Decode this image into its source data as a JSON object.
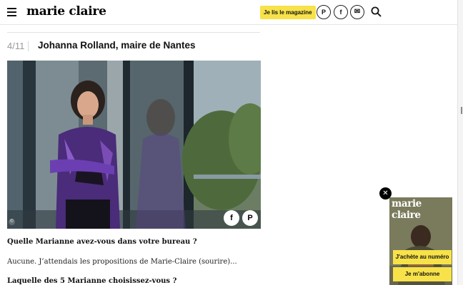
{
  "header": {
    "logo": "marie claire",
    "magazine_button": "Je lis le magazine",
    "social": [
      "P",
      "f",
      "✉"
    ]
  },
  "slide": {
    "counter": "4/11",
    "title": "Johanna Rolland, maire de Nantes",
    "copyright_symbol": "©",
    "share": [
      "f",
      "P"
    ]
  },
  "article": {
    "q1": "Quelle Marianne avez-vous dans votre bureau ?",
    "a1": "Aucune. J’attendais les propositions de Marie-Claire (sourire)...",
    "q2": "Laquelle des 5 Marianne choisissez-vous ?"
  },
  "promo": {
    "close": "✕",
    "cover_title": "marie claire",
    "buy_button": "J'achète au numéro",
    "subscribe_button": "Je m'abonne"
  },
  "colors": {
    "accent_yellow": "#f7e24a",
    "purple_top": "#6a3da8"
  }
}
